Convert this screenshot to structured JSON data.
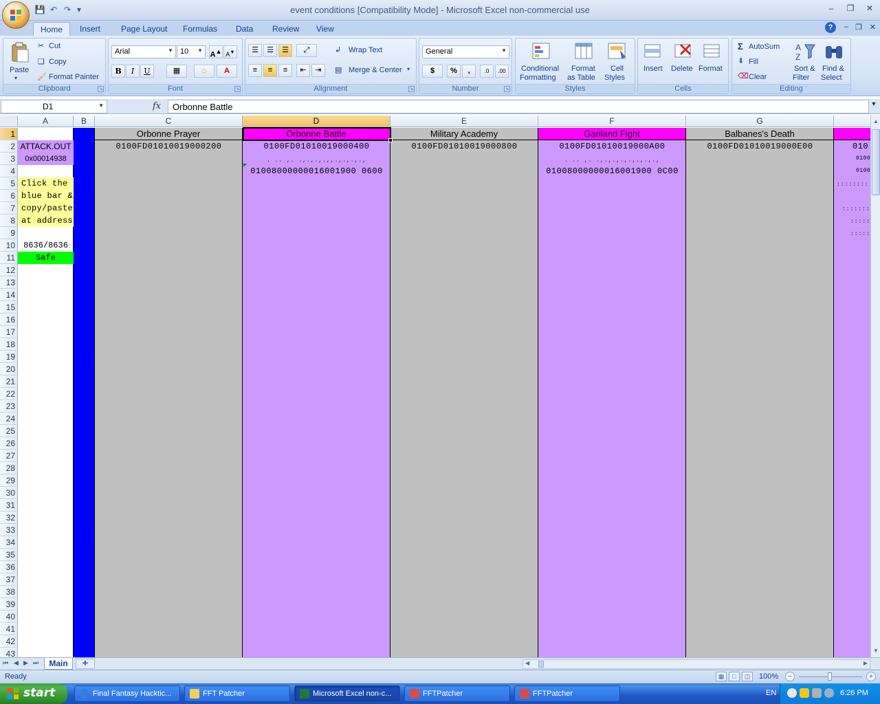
{
  "window": {
    "title": "event conditions  [Compatibility Mode] - Microsoft Excel non-commercial use"
  },
  "ribbon": {
    "tabs": [
      "Home",
      "Insert",
      "Page Layout",
      "Formulas",
      "Data",
      "Review",
      "View"
    ],
    "active_tab": "Home",
    "clipboard": {
      "paste": "Paste",
      "cut": "Cut",
      "copy": "Copy",
      "format_painter": "Format Painter",
      "label": "Clipboard"
    },
    "font": {
      "name": "Arial",
      "size": "10",
      "bold": "B",
      "italic": "I",
      "underline": "U",
      "label": "Font"
    },
    "alignment": {
      "wrap_text": "Wrap Text",
      "merge_center": "Merge & Center",
      "label": "Alignment"
    },
    "number": {
      "format": "General",
      "currency": "$",
      "percent": "%",
      "comma": ",",
      "label": "Number"
    },
    "styles": {
      "conditional": "Conditional",
      "conditional2": "Formatting",
      "format_table": "Format",
      "format_table2": "as Table",
      "cell_styles": "Cell",
      "cell_styles2": "Styles",
      "label": "Styles"
    },
    "cells": {
      "insert": "Insert",
      "delete": "Delete",
      "format": "Format",
      "label": "Cells"
    },
    "editing": {
      "autosum": "AutoSum",
      "fill": "Fill",
      "clear": "Clear",
      "sort": "Sort &",
      "sort2": "Filter",
      "find": "Find &",
      "find2": "Select",
      "label": "Editing"
    }
  },
  "formula_bar": {
    "name_box": "D1",
    "fx": "fx",
    "content": "Orbonne Battle"
  },
  "columns": [
    "A",
    "B",
    "C",
    "D",
    "E",
    "F",
    "G"
  ],
  "rows": [
    "1",
    "2",
    "3",
    "4",
    "5",
    "6",
    "7",
    "8",
    "9",
    "10",
    "11",
    "12",
    "13",
    "14",
    "15",
    "16",
    "17",
    "18",
    "19",
    "20",
    "21",
    "22",
    "23",
    "24",
    "25",
    "26",
    "27",
    "28",
    "29",
    "30",
    "31",
    "32",
    "33",
    "34",
    "35",
    "36",
    "37",
    "38",
    "39",
    "40",
    "41",
    "42",
    "43"
  ],
  "column_a": {
    "r2": "ATTACK.OUT",
    "r3": "0x00014938",
    "r5": "Click the",
    "r6": "blue bar &",
    "r7": "copy/paste",
    "r8": "at address",
    "r10": "8636/8636",
    "r11": "Safe"
  },
  "events": [
    {
      "name": "Orbonne Prayer",
      "code1": "0100FD01010019000200",
      "code2": "",
      "dots": ""
    },
    {
      "name": "Orbonne Battle",
      "code1": "0100FD01010019000400",
      "dots": ". .. ,. .,.,.,.,,.,.,.,.,",
      "code2": "01008000000016001900 0600"
    },
    {
      "name": "Military Academy",
      "code1": "0100FD01010019000800",
      "code2": "",
      "dots": ""
    },
    {
      "name": "Gariland Fight",
      "code1": "0100FD01010019000A00",
      "dots": ". .. ,. .,.,.,.,.,.,.,.,",
      "code2": "01008000000016001900 0C00"
    },
    {
      "name": "Balbanes's Death",
      "code1": "0100FD01010019000E00",
      "code2": "",
      "dots": ""
    }
  ],
  "partial_col": {
    "r2": "010",
    "r3": "0100",
    "r4": "0100"
  },
  "sheet_tabs": [
    "Main"
  ],
  "status": {
    "text": "Ready",
    "zoom": "100%"
  },
  "taskbar": {
    "start": "start",
    "tasks": [
      "Final Fantasy Hacktic...",
      "FFT Patcher",
      "Microsoft Excel non-c...",
      "FFTPatcher",
      "FFTPatcher"
    ],
    "language": "EN",
    "clock": "6:26 PM"
  },
  "colors": {
    "violet": "#cc99ff",
    "magenta": "#ff00ff",
    "gray": "#c0c0c0",
    "blue": "#0000ff",
    "yellow": "#ffff99",
    "green": "#00ff00"
  }
}
